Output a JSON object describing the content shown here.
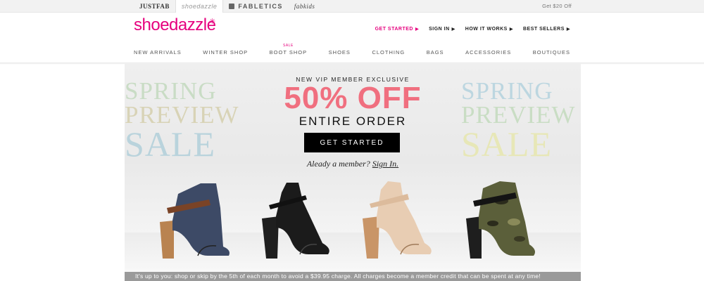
{
  "brand_bar": {
    "brands": [
      "JUSTFAB",
      "shoedazzle",
      "FABLETICS",
      "fabkids"
    ],
    "promo": "Get $20 Off"
  },
  "header": {
    "logo": "shoedazzle",
    "links": [
      {
        "label": "GET STARTED",
        "accent": "#e6007e"
      },
      {
        "label": "SIGN IN"
      },
      {
        "label": "HOW IT WORKS"
      },
      {
        "label": "BEST SELLERS"
      }
    ]
  },
  "nav": {
    "items": [
      "NEW ARRIVALS",
      "WINTER SHOP",
      "BOOT SHOP",
      "SHOES",
      "CLOTHING",
      "BAGS",
      "ACCESSORIES",
      "BOUTIQUES"
    ],
    "sale_tag": "SALE"
  },
  "hero": {
    "left_text": [
      "SPRING",
      "PREVIEW",
      "SALE"
    ],
    "right_text": [
      "SPRING",
      "PREVIEW",
      "SALE"
    ],
    "eyebrow": "NEW VIP MEMBER EXCLUSIVE",
    "offer": "50% OFF",
    "subhead": "ENTIRE ORDER",
    "cta": "GET STARTED",
    "member_prompt": "Aleady a member?",
    "sign_in": "Sign In.",
    "offer_color": "#f06f7f",
    "shoes": [
      {
        "name": "navy-denim-bootie",
        "color": "#3d4a66",
        "strap": "#7a4326",
        "heel": "#b98350"
      },
      {
        "name": "black-bootie",
        "color": "#1b1b1b",
        "strap": "#111111",
        "heel": "#1f1f1f"
      },
      {
        "name": "nude-bootie",
        "color": "#e8cdb3",
        "strap": "#dcbb9c",
        "heel": "#c99567"
      },
      {
        "name": "camo-bootie",
        "color": "#5b5f3a",
        "strap": "#141414",
        "heel": "#1e1e1e"
      }
    ]
  },
  "disclaimer": "It's up to you: shop or skip by the 5th of each month to avoid a $39.95 charge. All charges become a member credit that can be spent at any time!"
}
